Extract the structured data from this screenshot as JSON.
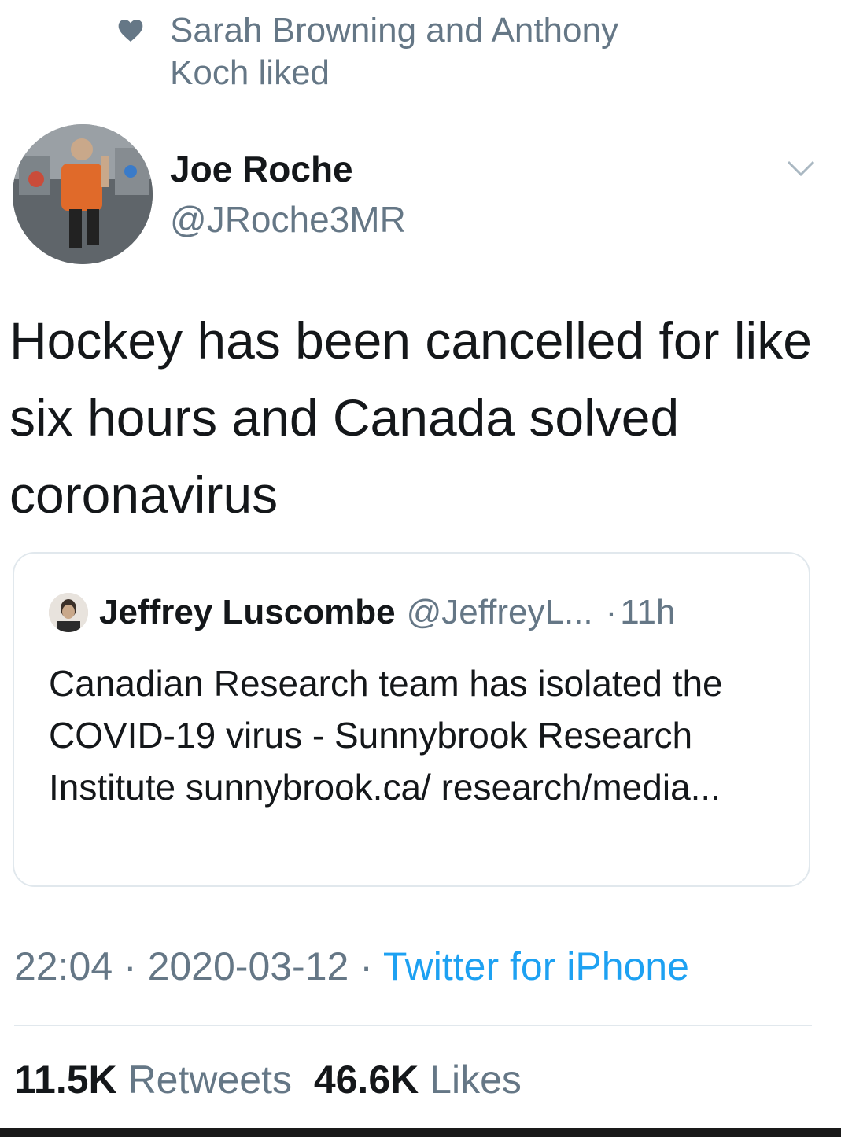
{
  "social_context": {
    "text": "Sarah Browning and Anthony Koch liked",
    "icon": "heart-icon"
  },
  "tweet": {
    "author_name": "Joe Roche",
    "author_handle": "@JRoche3MR",
    "text": "Hockey has been cancelled for like six hours and Canada solved coronavirus",
    "menu_icon": "chevron-down-icon"
  },
  "quote": {
    "author_name": "Jeffrey Luscombe",
    "author_handle": "@JeffreyL...",
    "separator": "·",
    "time": "11h",
    "text": "Canadian Research team has isolated the COVID-19 virus - Sunnybrook Research Institute sunnybrook.ca/ research/media..."
  },
  "meta": {
    "time": "22:04",
    "separator": " · ",
    "date": "2020-03-12",
    "source": "Twitter for iPhone"
  },
  "stats": {
    "retweets_count": "11.5K",
    "retweets_label": "Retweets",
    "likes_count": "46.6K",
    "likes_label": "Likes"
  },
  "colors": {
    "link": "#1da1f2",
    "secondary_text": "#657786",
    "primary_text": "#14171a",
    "divider": "#e1e8ed"
  }
}
